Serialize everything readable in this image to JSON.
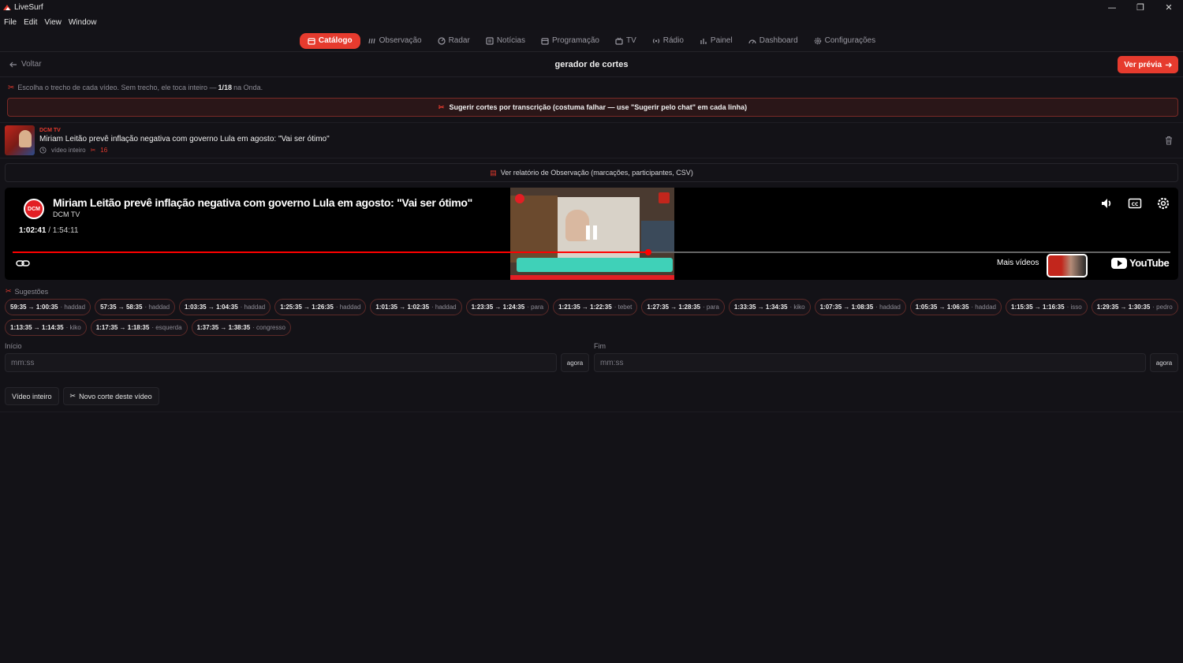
{
  "window": {
    "title": "LiveSurf",
    "minimize": "—",
    "maximize": "❐",
    "close": "✕"
  },
  "menu": {
    "file": "File",
    "edit": "Edit",
    "view": "View",
    "window": "Window"
  },
  "nav": {
    "catalogo": "Catálogo",
    "observacao": "Observação",
    "radar": "Radar",
    "noticias": "Notícias",
    "programacao": "Programação",
    "tv": "TV",
    "radio": "Rádio",
    "painel": "Painel",
    "dashboard": "Dashboard",
    "configuracoes": "Configurações"
  },
  "topbar": {
    "back": "Voltar",
    "title": "gerador de cortes",
    "preview": "Ver prévia"
  },
  "hint": {
    "text": "Escolha o trecho de cada vídeo. Sem trecho, ele toca inteiro —",
    "count": "1/18",
    "suffix": "na Onda."
  },
  "suggest_bar": "Sugerir cortes por transcrição (costuma falhar — use \"Sugerir pelo chat\" em cada linha)",
  "video": {
    "channel": "DCM TV",
    "title": "Miriam Leitão prevê inflação negativa com governo Lula em agosto: \"Vai ser ótimo\"",
    "duration_label": "vídeo inteiro",
    "cut_count": "16"
  },
  "report_bar": "Ver relatório de Observação (marcações, participantes, CSV)",
  "player": {
    "logo": "DCM",
    "title": "Miriam Leitão prevê inflação negativa com governo Lula em agosto: \"Vai ser ótimo\"",
    "channel": "DCM TV",
    "current": "1:02:41",
    "total": "/ 1:54:11",
    "progress": 0.549,
    "more_videos": "Mais vídeos",
    "youtube": "YouTube"
  },
  "suggestions": {
    "label": "Sugestões",
    "items": [
      {
        "range": "59:35 → 1:00:35",
        "who": "· haddad"
      },
      {
        "range": "57:35 → 58:35",
        "who": "· haddad"
      },
      {
        "range": "1:03:35 → 1:04:35",
        "who": "· haddad"
      },
      {
        "range": "1:25:35 → 1:26:35",
        "who": "· haddad"
      },
      {
        "range": "1:01:35 → 1:02:35",
        "who": "· haddad"
      },
      {
        "range": "1:23:35 → 1:24:35",
        "who": "· para"
      },
      {
        "range": "1:21:35 → 1:22:35",
        "who": "· tebet"
      },
      {
        "range": "1:27:35 → 1:28:35",
        "who": "· para"
      },
      {
        "range": "1:33:35 → 1:34:35",
        "who": "· kiko"
      },
      {
        "range": "1:07:35 → 1:08:35",
        "who": "· haddad"
      },
      {
        "range": "1:05:35 → 1:06:35",
        "who": "· haddad"
      },
      {
        "range": "1:15:35 → 1:16:35",
        "who": "· isso"
      },
      {
        "range": "1:29:35 → 1:30:35",
        "who": "· pedro"
      },
      {
        "range": "1:13:35 → 1:14:35",
        "who": "· kiko"
      },
      {
        "range": "1:17:35 → 1:18:35",
        "who": "· esquerda"
      },
      {
        "range": "1:37:35 → 1:38:35",
        "who": "· congresso"
      }
    ]
  },
  "fields": {
    "start_label": "Início",
    "end_label": "Fim",
    "placeholder": "mm:ss",
    "now": "agora"
  },
  "actions": {
    "whole": "Vídeo inteiro",
    "new_cut": "Novo corte deste vídeo"
  },
  "colors": {
    "accent": "#e63b2e",
    "background": "#131217"
  }
}
